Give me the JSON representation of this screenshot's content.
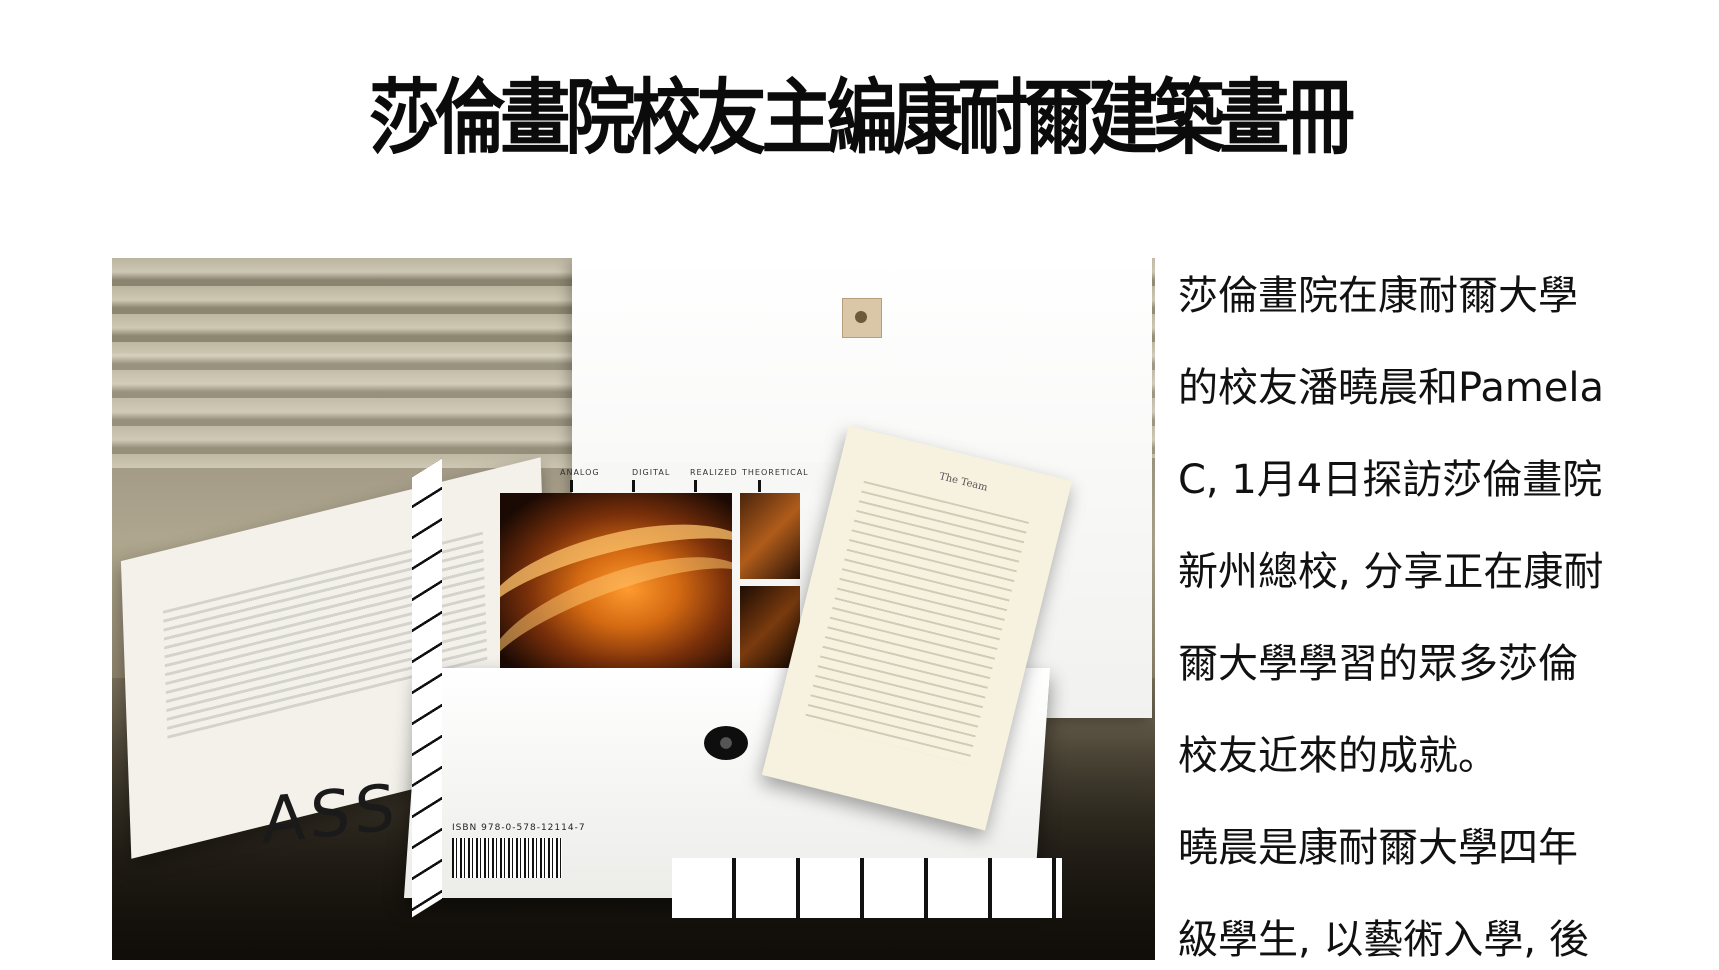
{
  "page": {
    "title": "莎倫畫院校友主編康耐爾建築畫冊"
  },
  "photo": {
    "book_letters": "ASS",
    "isbn": "ISBN 978-0-578-12114-7",
    "tabs": [
      "ANALOG",
      "DIGITAL",
      "REALIZED",
      "THEORETICAL"
    ],
    "sheet_title": "The Team"
  },
  "body": {
    "lines": [
      "莎倫畫院在康耐爾大學",
      "的校友潘曉晨和Pamela",
      "C, 1月4日探訪莎倫畫院",
      "新州總校, 分享正在康耐",
      "爾大學學習的眾多莎倫",
      "校友近來的成就。",
      "曉晨是康耐爾大學四年",
      "級學生, 以藝術入學, 後"
    ]
  }
}
